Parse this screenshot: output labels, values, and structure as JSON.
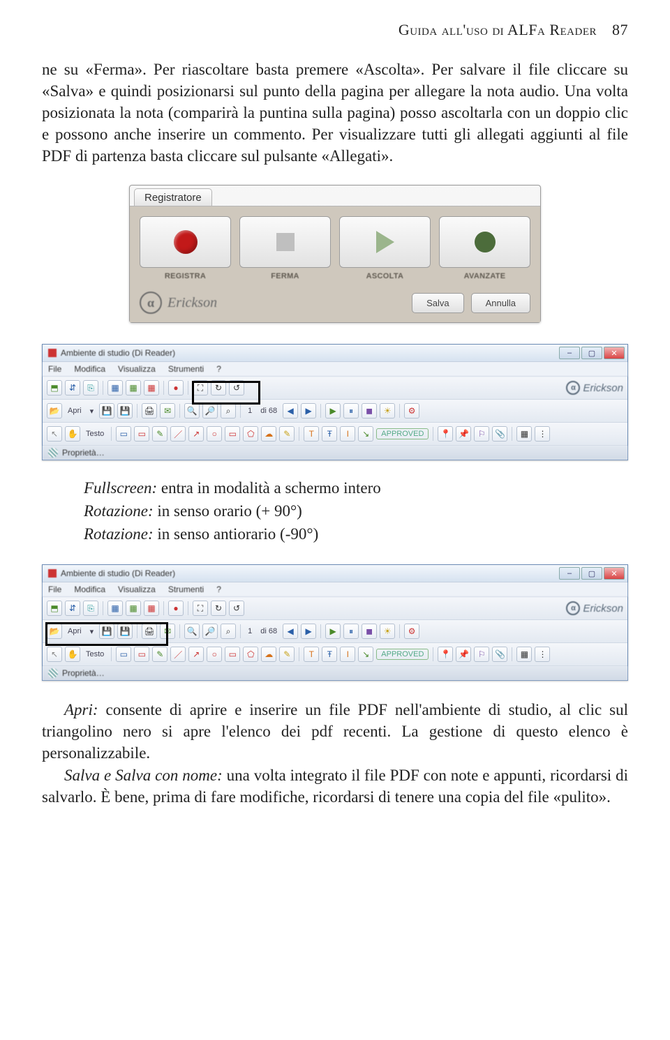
{
  "header": {
    "title": "Guida all'uso di ALFa Reader",
    "page_number": "87"
  },
  "para1": "ne su «Ferma». Per riascoltare basta premere «Ascolta». Per salvare il file cliccare su «Salva» e quindi posizionarsi sul punto della pagina per allegare la nota audio. Una volta posizionata la nota (comparirà la puntina sulla pagina) posso ascoltarla con un doppio clic e possono anche inserire un commento. Per visualizzare tutti gli allegati aggiunti al file PDF di partenza basta cliccare sul pulsante «Allegati».",
  "recorder": {
    "tab": "Registratore",
    "labels": {
      "rec": "REGISTRA",
      "stop": "FERMA",
      "play": "ASCOLTA",
      "adv": "AVANZATE"
    },
    "logo": "Erickson",
    "save": "Salva",
    "cancel": "Annulla"
  },
  "app": {
    "title": "Ambiente di studio (Di Reader)",
    "menu": [
      "File",
      "Modifica",
      "Visualizza",
      "Strumenti",
      "?"
    ],
    "page_field": "1",
    "page_total": "di 68",
    "open_label": "Apri",
    "testo_label": "Testo",
    "approved": "APPROVED",
    "properties": "Proprietà…",
    "logo": "Erickson"
  },
  "captions1": {
    "l1a": "Fullscreen:",
    "l1b": " entra in modalità a schermo intero",
    "l2a": "Rotazione:",
    "l2b": " in senso orario (+ 90°)",
    "l3a": "Rotazione:",
    "l3b": " in senso antiorario (-90°)"
  },
  "para2a": "Apri:",
  "para2a_rest": " consente di aprire e inserire un file PDF nell'ambiente di studio, al clic sul triangolino nero si apre l'elenco dei pdf recenti. La gestione di questo elenco è personalizzabile.",
  "para2b": "Salva e Salva con nome:",
  "para2b_rest": " una volta integrato il file PDF con note e appunti, ricordarsi di salvarlo. È bene, prima di fare modifiche, ricordarsi di tenere una copia del file «pulito»."
}
